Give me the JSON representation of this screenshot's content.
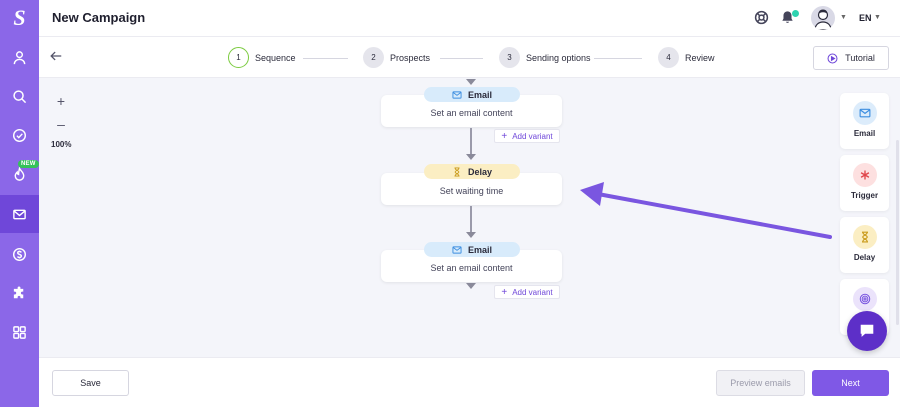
{
  "app": {
    "title": "New Campaign",
    "language": "EN"
  },
  "sidebar": {
    "logo": "S",
    "new_badge": "NEW",
    "items": [
      {
        "icon": "user-icon"
      },
      {
        "icon": "search-icon"
      },
      {
        "icon": "check-circle-icon"
      },
      {
        "icon": "fire-icon"
      },
      {
        "icon": "mail-icon",
        "active": true
      },
      {
        "icon": "dollar-icon"
      },
      {
        "icon": "puzzle-icon"
      },
      {
        "icon": "grid-icon"
      }
    ]
  },
  "stepper": {
    "steps": [
      {
        "num": "1",
        "label": "Sequence",
        "active": true
      },
      {
        "num": "2",
        "label": "Prospects"
      },
      {
        "num": "3",
        "label": "Sending options"
      },
      {
        "num": "4",
        "label": "Review"
      }
    ],
    "tutorial_label": "Tutorial"
  },
  "zoom": {
    "plus": "+",
    "minus": "–",
    "level": "100%"
  },
  "flow": {
    "nodes": [
      {
        "type": "Email",
        "content": "Set an email content"
      },
      {
        "type": "Delay",
        "content": "Set waiting time"
      },
      {
        "type": "Email",
        "content": "Set an email content"
      }
    ],
    "add_variant_label": "Add variant",
    "add_variant_plus": "+"
  },
  "palette": [
    {
      "label": "Email",
      "icon": "mail-icon",
      "color": "#dcecfb"
    },
    {
      "label": "Trigger",
      "icon": "asterisk-icon",
      "color": "#fde0e0"
    },
    {
      "label": "Delay",
      "icon": "hourglass-icon",
      "color": "#fbeec3"
    },
    {
      "label": "",
      "icon": "target-icon",
      "color": "#ebe3fb"
    }
  ],
  "footer": {
    "save_label": "Save",
    "preview_label": "Preview emails",
    "next_label": "Next"
  },
  "colors": {
    "sidebar": "#8b67e8",
    "accent": "#7f58e6",
    "step_active": "#7bcb3f",
    "arrow": "#7a56e0"
  }
}
